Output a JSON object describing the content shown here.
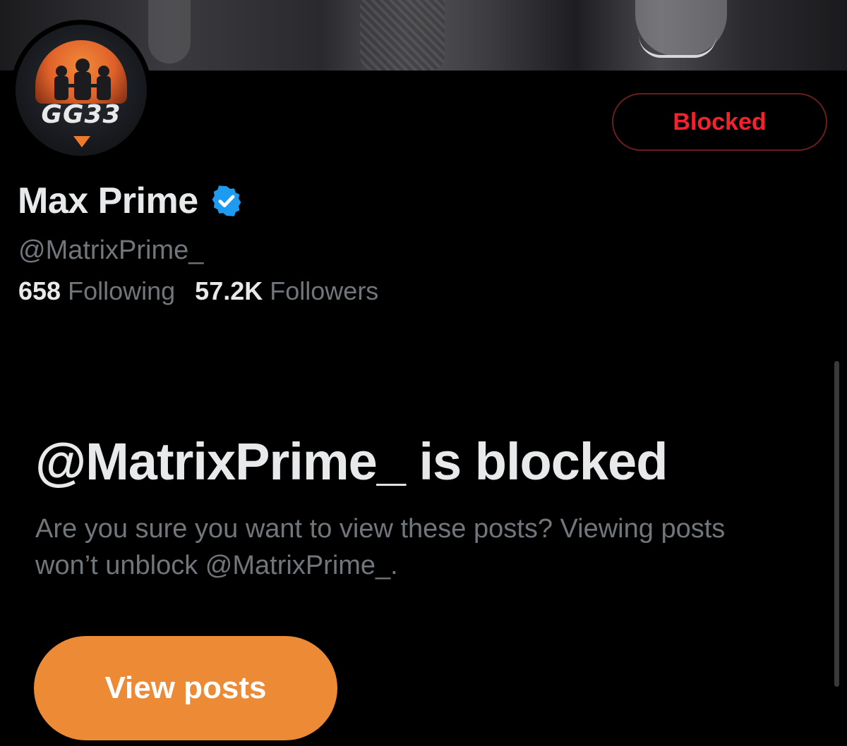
{
  "header": {
    "banner_icon": "banner-image",
    "avatar": {
      "icon": "avatar-logo",
      "logo_text": "GG33"
    },
    "blocked_button_label": "Blocked",
    "blocked_color": "#f4212e"
  },
  "profile": {
    "display_name": "Max Prime",
    "verified_icon": "verified-badge-icon",
    "verified_color": "#1d9bf0",
    "handle": "@MatrixPrime_",
    "following_count": "658",
    "following_label": "Following",
    "followers_count": "57.2K",
    "followers_label": "Followers"
  },
  "blocked_notice": {
    "title": "@MatrixPrime_ is blocked",
    "description": "Are you sure you want to view these posts? Viewing posts won’t unblock @MatrixPrime_.",
    "view_button_label": "View posts",
    "view_button_color": "#ed8a36"
  }
}
